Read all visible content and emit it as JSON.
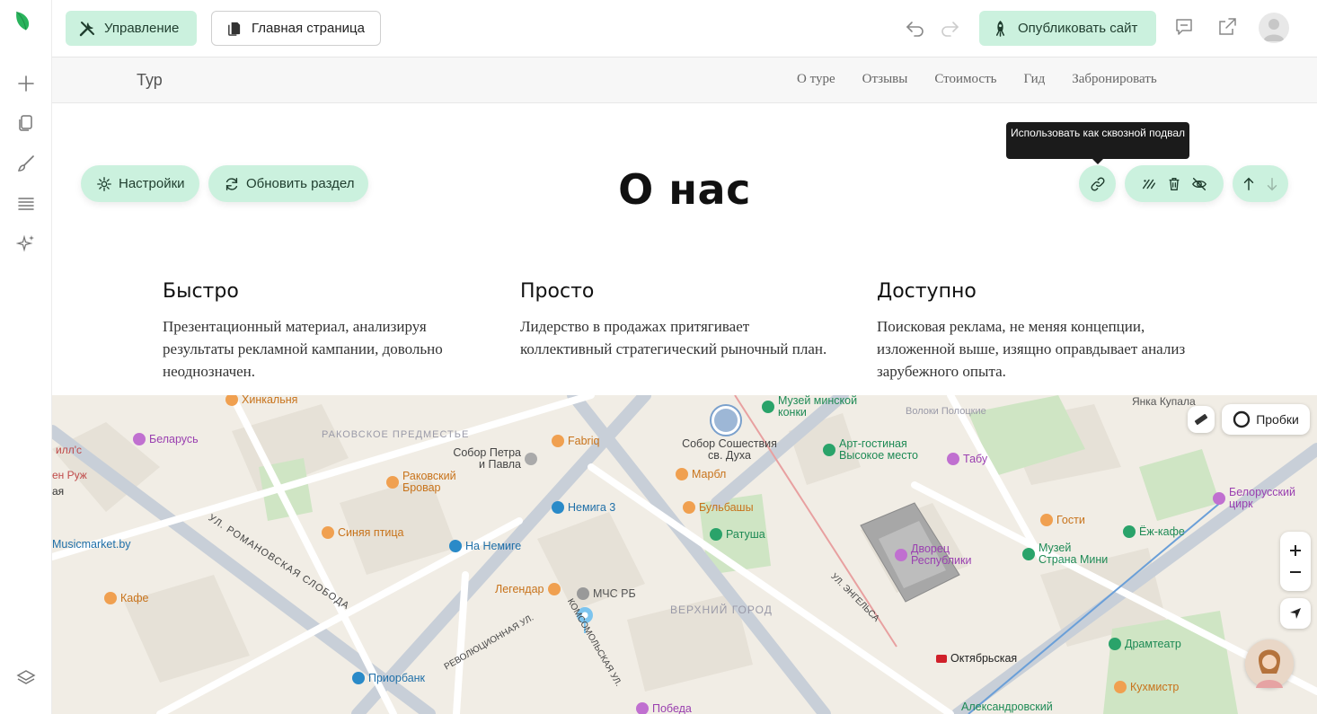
{
  "toolbar": {
    "manage_label": "Управление",
    "home_label": "Главная страница",
    "publish_label": "Опубликовать сайт"
  },
  "site_header": {
    "logo": "Тур",
    "nav": [
      "О туре",
      "Отзывы",
      "Стоимость",
      "Гид",
      "Забронировать"
    ]
  },
  "section_controls": {
    "settings_label": "Настройки",
    "refresh_label": "Обновить раздел",
    "tooltip": "Использовать как сквозной подвал"
  },
  "section": {
    "title": "О нас",
    "features": [
      {
        "heading": "Быстро",
        "text": "Презентационный материал, анализируя результаты рекламной кампании, довольно неоднозначен."
      },
      {
        "heading": "Просто",
        "text": "Лидерство в продажах притягивает коллективный стратегический рыночный план."
      },
      {
        "heading": "Доступно",
        "text": "Поисковая реклама, не меняя концепции, изложенной выше, изящно оправдывает анализ зарубежного опыта."
      }
    ]
  },
  "map": {
    "traffic_label": "Пробки",
    "street_labels": [
      "УЛ. РОМАНОВСКАЯ СЛОБОДА",
      "РАКОВСКОЕ ПРЕДМЕСТЬЕ",
      "ВЕРХНИЙ ГОРОД",
      "УЛ. ЭНГЕЛЬСА",
      "КОМСОМОЛЬСКАЯ УЛ.",
      "РЕВОЛЮЦИОННАЯ УЛ.",
      "Волоки Полоцкие"
    ],
    "pois": [
      {
        "name": "Хинкальня",
        "color": "#f0a050"
      },
      {
        "name": "Беларусь",
        "color": "#c070d0"
      },
      {
        "name": "Раковский Бровар",
        "color": "#f0a050"
      },
      {
        "name": "Синяя птица",
        "color": "#f0a050"
      },
      {
        "name": "Musicmarket.by",
        "color": "#2a8ac8"
      },
      {
        "name": "Кафе",
        "color": "#f0a050"
      },
      {
        "name": "Fabriq",
        "color": "#f0a050"
      },
      {
        "name": "Собор Петра и Павла",
        "color": "#888888"
      },
      {
        "name": "Немига 3",
        "color": "#2a8ac8"
      },
      {
        "name": "На Немиге",
        "color": "#2a8ac8"
      },
      {
        "name": "Легендар",
        "color": "#f0a050"
      },
      {
        "name": "МЧС РБ",
        "color": "#888888"
      },
      {
        "name": "Приорбанк",
        "color": "#2a8ac8"
      },
      {
        "name": "Собор Сошествия св. Духа",
        "color": "#888888"
      },
      {
        "name": "Марбл",
        "color": "#f0a050"
      },
      {
        "name": "Бульбашы",
        "color": "#f0a050"
      },
      {
        "name": "Ратуша",
        "color": "#2aa36a"
      },
      {
        "name": "Музей минской конки",
        "color": "#2aa36a"
      },
      {
        "name": "Арт-гостиная Высокое место",
        "color": "#2aa36a"
      },
      {
        "name": "Табу",
        "color": "#c070d0"
      },
      {
        "name": "Дворец Республики",
        "color": "#c070d0"
      },
      {
        "name": "Гости",
        "color": "#f0a050"
      },
      {
        "name": "Ёж-кафе",
        "color": "#2aa36a"
      },
      {
        "name": "Музей Страна Мини",
        "color": "#2aa36a"
      },
      {
        "name": "Белорусский цирк",
        "color": "#c070d0"
      },
      {
        "name": "Драмтеатр",
        "color": "#2aa36a"
      },
      {
        "name": "Кухмистр",
        "color": "#f0a050"
      },
      {
        "name": "Октябрьская",
        "color": "#d0202a"
      },
      {
        "name": "Александровский",
        "color": "#2aa36a"
      },
      {
        "name": "Победа",
        "color": "#c070d0"
      },
      {
        "name": "Янка Купала",
        "color": "#555555"
      }
    ],
    "edge_fragments": [
      "илл'с",
      "ен Руж",
      "ая"
    ]
  },
  "colors": {
    "accent": "#cbf1de",
    "accent_text": "#1f3d2e",
    "brand_green": "#2aa36a",
    "tooltip_bg": "#1b1b1b"
  },
  "icons": {
    "logo": "leaf-logo",
    "rail": [
      "plus-icon",
      "pages-icon",
      "brush-icon",
      "list-icon",
      "sparkle-icon",
      "layers-icon"
    ]
  }
}
